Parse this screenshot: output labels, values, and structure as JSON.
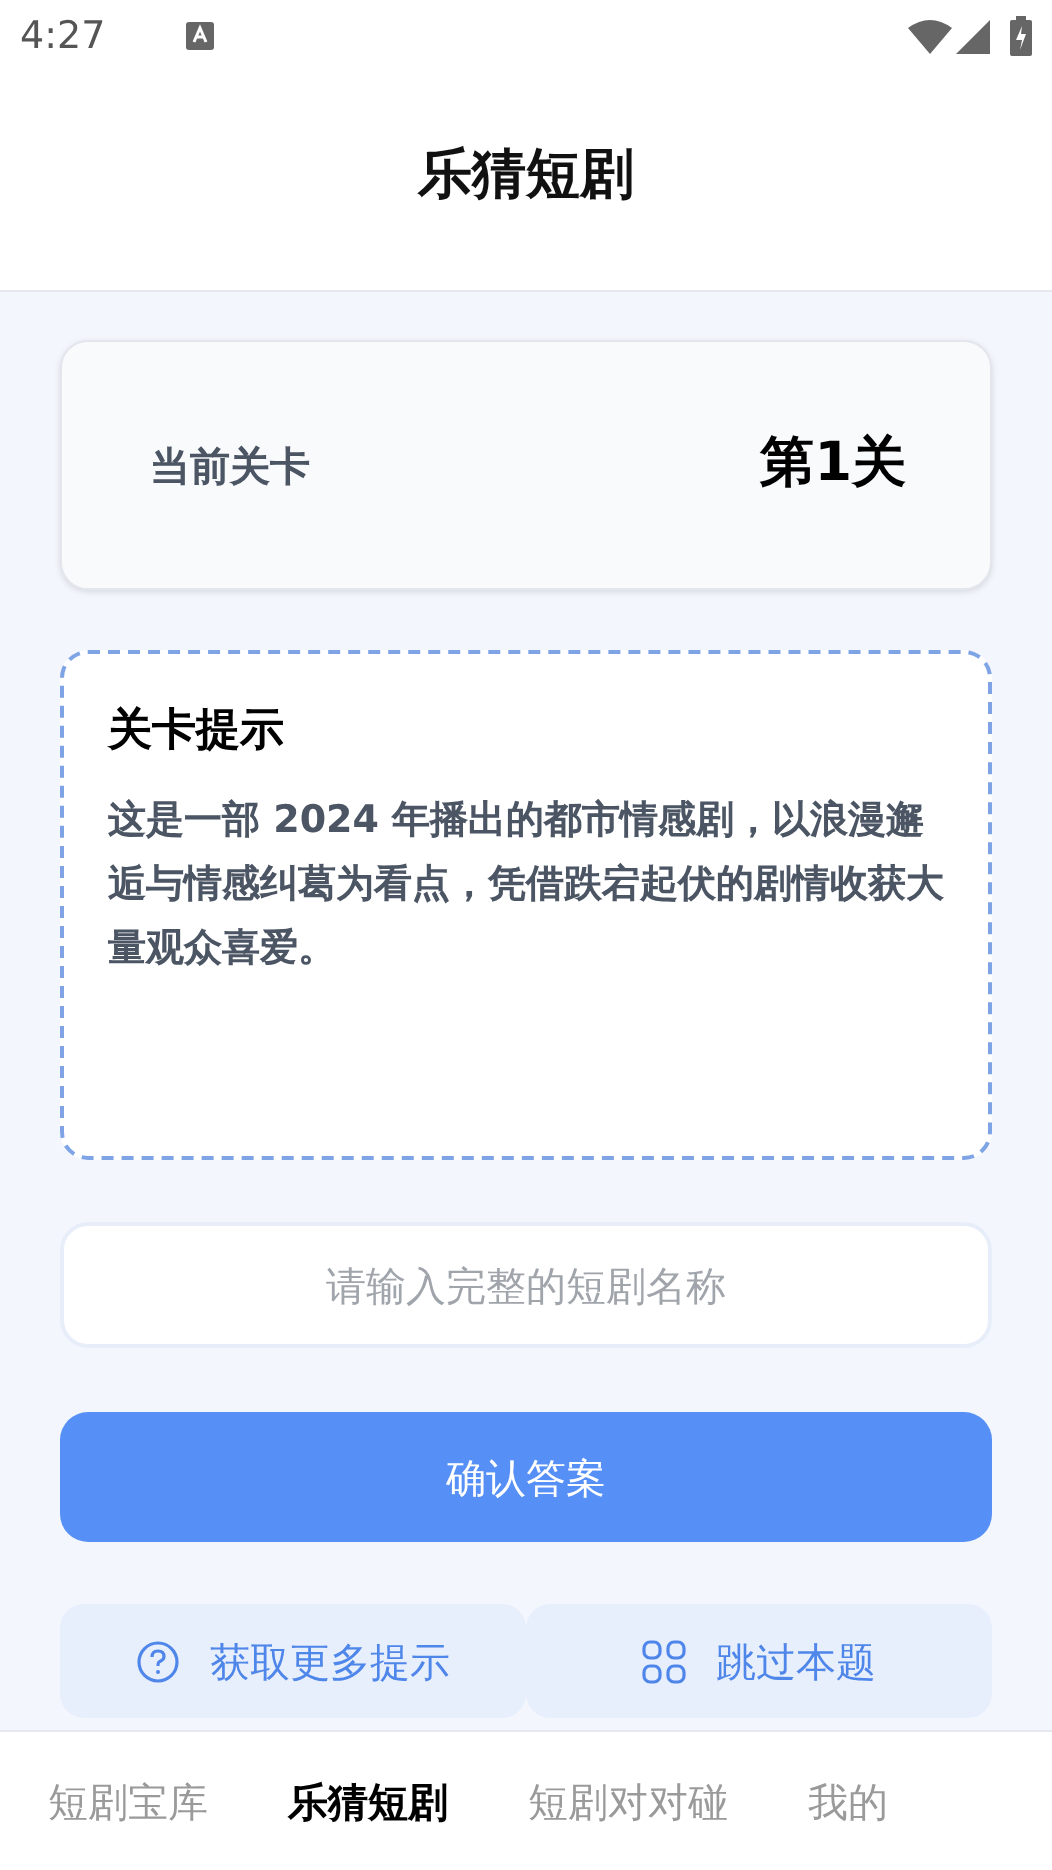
{
  "status_bar": {
    "time": "4:27"
  },
  "header": {
    "title": "乐猜短剧"
  },
  "level_card": {
    "label": "当前关卡",
    "value": "第1关"
  },
  "hint_card": {
    "title": "关卡提示",
    "text": "这是一部 2024 年播出的都市情感剧，以浪漫邂逅与情感纠葛为看点，凭借跌宕起伏的剧情收获大量观众喜爱。"
  },
  "answer_field": {
    "placeholder": "请输入完整的短剧名称"
  },
  "confirm_button": {
    "label": "确认答案"
  },
  "actions": [
    {
      "kind": "hint",
      "label": "获取更多提示"
    },
    {
      "kind": "skip",
      "label": "跳过本题"
    }
  ],
  "tabs": [
    {
      "label": "短剧宝库",
      "selected": false
    },
    {
      "label": "乐猜短剧",
      "selected": true
    },
    {
      "label": "短剧对对碰",
      "selected": false
    },
    {
      "label": "我的",
      "selected": false
    }
  ]
}
